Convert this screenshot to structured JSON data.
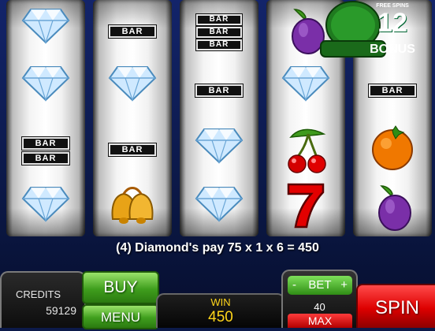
{
  "reels": [
    {
      "symbols": [
        "diamond",
        "diamond",
        "bar-double",
        "diamond"
      ]
    },
    {
      "symbols": [
        "bar",
        "diamond",
        "bar",
        "bells"
      ]
    },
    {
      "symbols": [
        "bar-triple",
        "bar",
        "diamond",
        "diamond"
      ]
    },
    {
      "symbols": [
        "plum",
        "diamond",
        "cherries",
        "seven"
      ]
    },
    {
      "symbols": [
        "free-spins-bonus",
        "bar",
        "orange",
        "plum"
      ]
    }
  ],
  "bar_label": "BAR",
  "bonus": {
    "top_text": "FREE SPINS",
    "number": "12",
    "label": "BONUS"
  },
  "payline_text": "(4) Diamond's pay 75 x 1 x 6 = 450",
  "credits": {
    "label": "CREDITS",
    "value": "59129"
  },
  "buttons": {
    "buy": "BUY",
    "menu": "MENU",
    "spin": "SPIN",
    "max": "MAX"
  },
  "win": {
    "label": "WIN",
    "value": "450"
  },
  "bet": {
    "minus": "-",
    "label": "BET",
    "plus": "+",
    "value": "40"
  },
  "colors": {
    "background": "#0c1a4a",
    "green": "#3f9e1d",
    "red": "#d00000",
    "gold": "#ffd51a"
  }
}
